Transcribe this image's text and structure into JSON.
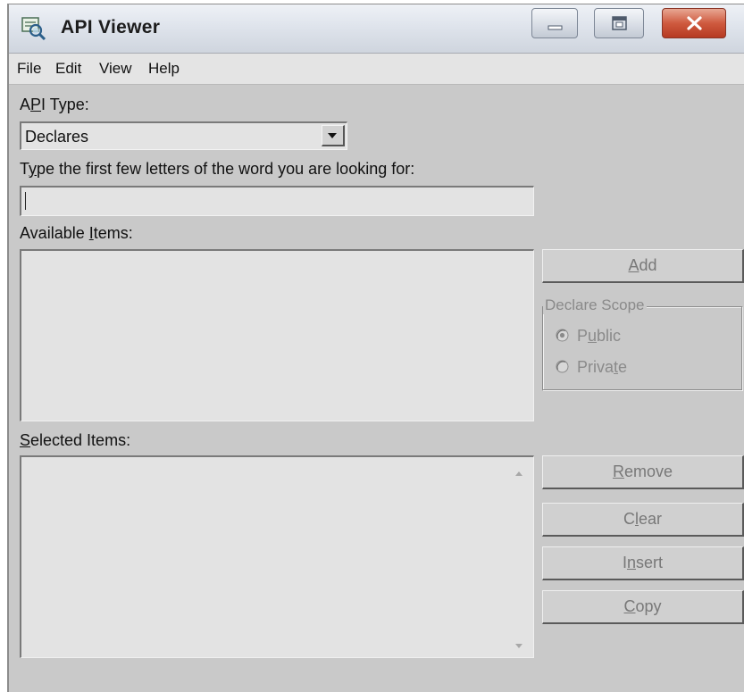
{
  "window": {
    "title": "API Viewer",
    "icon": "api-viewer-app-icon",
    "controls": {
      "minimize_icon": "minimize-icon",
      "maximize_icon": "maximize-icon",
      "close_icon": "close-icon",
      "close_color": "#c8492f"
    }
  },
  "menu": {
    "items": [
      "File",
      "Edit",
      "View",
      "Help"
    ]
  },
  "api_type": {
    "label_pre": "A",
    "label_underlined": "P",
    "label_post": "I Type:",
    "selected": "Declares"
  },
  "search": {
    "label_pre": "T",
    "label_underlined": "y",
    "label_post": "pe the first few letters of the word you are looking for:",
    "value": ""
  },
  "available": {
    "label_pre": "Available ",
    "label_underlined": "I",
    "label_post": "tems:",
    "items": []
  },
  "selected": {
    "label_pre": "",
    "label_underlined": "S",
    "label_post": "elected Items:",
    "items": []
  },
  "buttons": {
    "add": {
      "pre": "",
      "u": "A",
      "post": "dd"
    },
    "remove": {
      "pre": "",
      "u": "R",
      "post": "emove"
    },
    "clear": {
      "pre": "C",
      "u": "l",
      "post": "ear"
    },
    "insert": {
      "pre": "I",
      "u": "n",
      "post": "sert"
    },
    "copy": {
      "pre": "",
      "u": "C",
      "post": "opy"
    }
  },
  "declare_scope": {
    "legend": "Declare Scope",
    "public": {
      "pre": "P",
      "u": "u",
      "post": "blic",
      "checked": true
    },
    "private": {
      "pre": "Priva",
      "u": "t",
      "post": "e",
      "checked": false
    }
  }
}
